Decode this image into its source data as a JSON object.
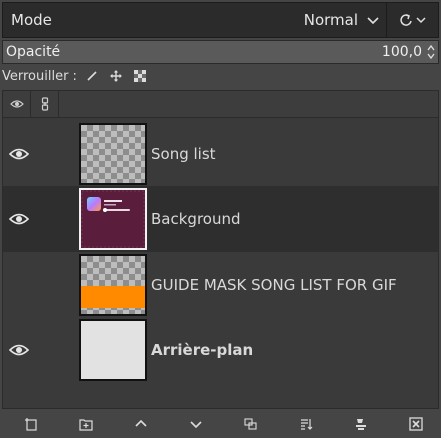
{
  "mode": {
    "label": "Mode",
    "value": "Normal"
  },
  "opacity": {
    "label": "Opacité",
    "value": "100,0"
  },
  "lock": {
    "label": "Verrouiller :"
  },
  "layers": [
    {
      "name": "Song list",
      "visible": true,
      "selected": false,
      "thumb": "transparent"
    },
    {
      "name": "Background",
      "visible": true,
      "selected": true,
      "thumb": "purple-ui"
    },
    {
      "name": "GUIDE MASK SONG LIST FOR GIF",
      "visible": false,
      "selected": false,
      "thumb": "orange-band"
    },
    {
      "name": "Arrière-plan",
      "visible": true,
      "selected": false,
      "thumb": "white",
      "bold": true
    }
  ],
  "toolbar": {
    "buttons": [
      "new-layer-icon",
      "new-layer-group-icon",
      "raise-layer-icon",
      "lower-layer-icon",
      "duplicate-layer-icon",
      "anchor-merge-icon",
      "layer-mask-icon",
      "delete-layer-icon"
    ]
  },
  "colors": {
    "panel_bg": "#454545",
    "list_bg": "#3a3a3a",
    "selected_row": "#2e2e2e",
    "orange": "#ff8a00",
    "purple": "#5a1d3c"
  }
}
